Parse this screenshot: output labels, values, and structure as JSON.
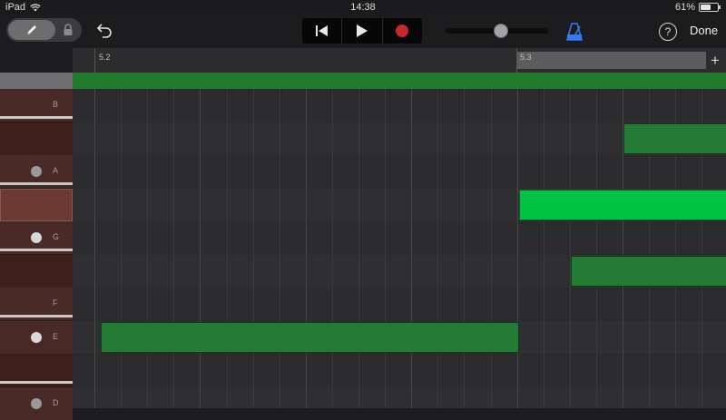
{
  "status": {
    "device": "iPad",
    "time": "14:38",
    "battery": "61%",
    "battery_level": 0.61
  },
  "toolbar": {
    "tools": {
      "pencil": "pencil-icon",
      "lock": "lock-icon"
    },
    "undo": "undo-icon",
    "transport": [
      "go-to-beginning-icon",
      "play-icon",
      "record-icon"
    ],
    "volume_level": 0.55,
    "metronome_color": "#2f7cf6",
    "help_label": "?",
    "done_label": "Done"
  },
  "ruler": {
    "markers": [
      "5.2",
      "5.3"
    ],
    "add_label": "+"
  },
  "keys": [
    {
      "name": "B",
      "kind": "natural"
    },
    {
      "name": "",
      "kind": "sharp"
    },
    {
      "name": "A",
      "kind": "natural",
      "dot": "dim"
    },
    {
      "name": "",
      "kind": "sharp",
      "selected": true
    },
    {
      "name": "G",
      "kind": "natural",
      "dot": "bright"
    },
    {
      "name": "",
      "kind": "sharp"
    },
    {
      "name": "F",
      "kind": "natural"
    },
    {
      "name": "E",
      "kind": "natural",
      "dot": "bright"
    },
    {
      "name": "",
      "kind": "sharp"
    },
    {
      "name": "D",
      "kind": "natural",
      "dot": "dim"
    }
  ],
  "colors": {
    "note": "#237a34",
    "note_active": "#00c342",
    "region": "#217a2d"
  },
  "notes": [
    {
      "lane": 1,
      "start": 0.84,
      "length": 0.16,
      "active": false
    },
    {
      "lane": 3,
      "start": 0.68,
      "length": 0.32,
      "active": true
    },
    {
      "lane": 5,
      "start": 0.76,
      "length": 0.24,
      "active": false
    },
    {
      "lane": 7,
      "start": 0.04,
      "length": 0.64,
      "active": false
    }
  ]
}
